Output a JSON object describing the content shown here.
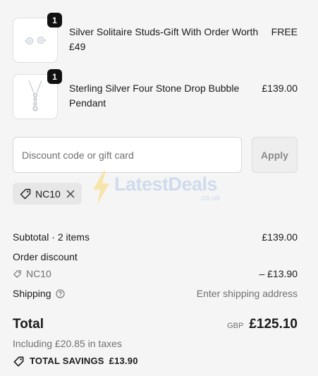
{
  "items": [
    {
      "quantity": "1",
      "name": "Silver Solitaire Studs-Gift With Order Worth £49",
      "price": "FREE",
      "image_icon": "stud-earrings-image"
    },
    {
      "quantity": "1",
      "name": "Sterling Silver Four Stone Drop Bubble Pendant",
      "price": "£139.00",
      "image_icon": "pendant-necklace-image"
    }
  ],
  "discount": {
    "placeholder": "Discount code or gift card",
    "value": "",
    "apply_label": "Apply",
    "applied_code": "NC10"
  },
  "watermark": {
    "text": "LatestDeals",
    "sub": ".co.uk"
  },
  "summary": {
    "subtotal_label": "Subtotal · 2 items",
    "subtotal_value": "£139.00",
    "order_discount_label": "Order discount",
    "discount_code": "NC10",
    "discount_value": "– £13.90",
    "shipping_label": "Shipping",
    "shipping_value": "Enter shipping address",
    "total_label": "Total",
    "currency": "GBP",
    "total_value": "£125.10",
    "tax_note": "Including £20.85 in taxes",
    "savings_label": "TOTAL SAVINGS",
    "savings_value": "£13.90"
  },
  "colors": {
    "background": "#f5f5f5",
    "text": "#1a1a1a",
    "muted": "#707070",
    "chip": "#e7e7e7",
    "badge": "#111111"
  }
}
